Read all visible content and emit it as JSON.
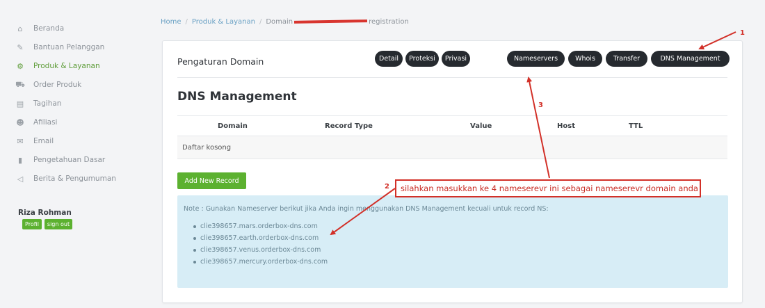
{
  "sidebar": {
    "items": [
      {
        "label": "Beranda",
        "icon": "home-icon",
        "glyph": "⌂"
      },
      {
        "label": "Bantuan Pelanggan",
        "icon": "wrench-icon",
        "glyph": "✎"
      },
      {
        "label": "Produk & Layanan",
        "icon": "cogs-icon",
        "glyph": "⚙"
      },
      {
        "label": "Order Produk",
        "icon": "cart-icon",
        "glyph": "⛟"
      },
      {
        "label": "Tagihan",
        "icon": "file-icon",
        "glyph": "▤"
      },
      {
        "label": "Afiliasi",
        "icon": "users-icon",
        "glyph": "☻"
      },
      {
        "label": "Email",
        "icon": "envelope-icon",
        "glyph": "✉"
      },
      {
        "label": "Pengetahuan Dasar",
        "icon": "book-icon",
        "glyph": "▮"
      },
      {
        "label": "Berita & Pengumuman",
        "icon": "bullhorn-icon",
        "glyph": "◁"
      }
    ],
    "user": {
      "name": "Riza Rohman",
      "profile_label": "Profil",
      "signout_label": "sign out"
    }
  },
  "breadcrumb": {
    "home": "Home",
    "products": "Produk & Layanan",
    "domain_prefix": "Domain",
    "domain_suffix": "registration"
  },
  "panel": {
    "title": "Pengaturan Domain",
    "tabs": [
      "Detail",
      "Proteksi",
      "Privasi",
      "Nameservers",
      "Whois",
      "Transfer",
      "DNS Management"
    ],
    "section_title": "DNS Management",
    "table": {
      "headers": [
        "Domain",
        "Record Type",
        "Value",
        "Host",
        "TTL"
      ],
      "empty_text": "Daftar kosong"
    },
    "add_button": "Add New Record",
    "note": "Note : Gunakan Nameserver berikut jika Anda ingin menggunakan DNS Management kecuali untuk record NS:",
    "nameservers": [
      "clie398657.mars.orderbox-dns.com",
      "clie398657.earth.orderbox-dns.com",
      "clie398657.venus.orderbox-dns.com",
      "clie398657.mercury.orderbox-dns.com"
    ]
  },
  "annotations": {
    "num1": "1",
    "num2": "2",
    "num3": "3",
    "callout": "silahkan masukkan ke 4 nameserevr ini sebagai nameserevr domain anda",
    "color": "#d23028"
  },
  "colors": {
    "accent_green": "#5cb130",
    "tab_dark": "#262a2f",
    "note_bg": "#d7edf6",
    "link_blue": "#6aa1c4"
  }
}
